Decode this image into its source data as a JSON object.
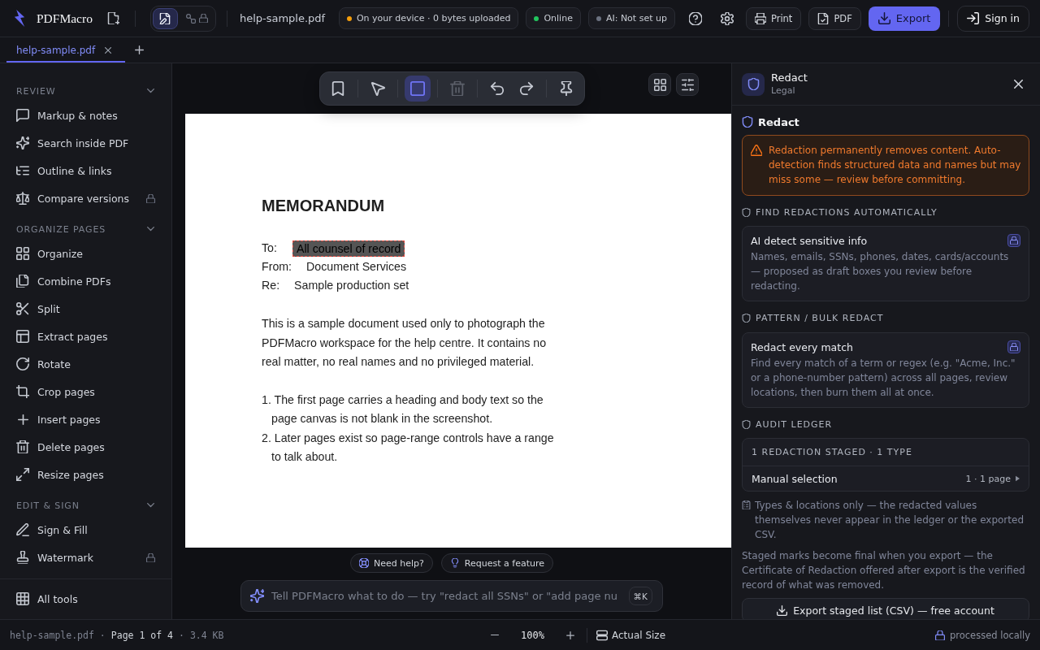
{
  "top_bar": {
    "brand": "PDFMacro",
    "modes": [
      {
        "selected": true,
        "locked": false
      },
      {
        "selected": false,
        "locked": true
      }
    ],
    "file_name": "help-sample.pdf",
    "status_pills": [
      {
        "label": "On your device · 0 bytes uploaded",
        "color": "#f59e0b"
      },
      {
        "label": "Online",
        "color": "#22c55e"
      },
      {
        "label": "AI: Not set up",
        "color": "#6b7280"
      }
    ],
    "buttons": [
      {
        "label": "Print",
        "kind": "secondary"
      },
      {
        "label": "PDF",
        "kind": "secondary"
      },
      {
        "label": "Export",
        "kind": "primary"
      },
      {
        "label": "Sign in",
        "kind": "outline"
      }
    ]
  },
  "tabs": [
    {
      "label": "help-sample.pdf",
      "selected": true
    }
  ],
  "sidebar": {
    "sections": [
      {
        "title": "REVIEW",
        "expanded": true,
        "items": [
          {
            "label": "Markup & notes",
            "locked": false
          },
          {
            "label": "Search inside PDF",
            "locked": false
          },
          {
            "label": "Outline & links",
            "locked": false
          },
          {
            "label": "Compare versions",
            "locked": true
          }
        ]
      },
      {
        "title": "ORGANIZE PAGES",
        "expanded": true,
        "items": [
          {
            "label": "Organize",
            "locked": false
          },
          {
            "label": "Combine PDFs",
            "locked": false
          },
          {
            "label": "Split",
            "locked": false
          },
          {
            "label": "Extract pages",
            "locked": false
          },
          {
            "label": "Rotate",
            "locked": false
          },
          {
            "label": "Crop pages",
            "locked": false
          },
          {
            "label": "Insert pages",
            "locked": false
          },
          {
            "label": "Delete pages",
            "locked": false
          },
          {
            "label": "Resize pages",
            "locked": false
          }
        ]
      },
      {
        "title": "EDIT & SIGN",
        "expanded": true,
        "items": [
          {
            "label": "Sign & Fill",
            "locked": false
          },
          {
            "label": "Watermark",
            "locked": true
          }
        ]
      }
    ],
    "footer_item": "All tools"
  },
  "toolbar": {
    "tools": [
      {
        "selected": false,
        "disabled": false
      },
      {
        "selected": false,
        "disabled": false
      },
      {
        "selected": true,
        "disabled": false
      },
      {
        "selected": false,
        "disabled": true
      },
      {
        "selected": false,
        "disabled": false
      },
      {
        "selected": false,
        "disabled": false
      },
      {
        "selected": false,
        "disabled": false
      }
    ]
  },
  "document": {
    "heading": "MEMORANDUM",
    "fields": [
      {
        "label": "To:",
        "value": "All counsel of record",
        "redacted": true
      },
      {
        "label": "From:",
        "value": "Document Services",
        "redacted": false
      },
      {
        "label": "Re:",
        "value": "Sample production set",
        "redacted": false
      }
    ],
    "body": "This is a sample document used only to photograph the PDFMacro workspace for the help centre. It contains no real matter, no real names and no privileged material.",
    "list": [
      "1. The first page carries a heading and body text so the page canvas is not blank in the screenshot.",
      "2. Later pages exist so page-range controls have a range to talk about."
    ]
  },
  "help_links": [
    "Need help?",
    "Request a feature"
  ],
  "command_bar": {
    "placeholder": "Tell PDFMacro what to do — try \"redact all SSNs\" or \"add page nu",
    "shortcut": "⌘K"
  },
  "panel": {
    "title": "Redact",
    "subtitle": "Legal",
    "heading": "Redact",
    "warning": "Redaction permanently removes content. Auto-detection finds structured data and names but may miss some — review before committing.",
    "sections": [
      {
        "kind": "feature",
        "title": "FIND REDACTIONS AUTOMATICALLY",
        "card": {
          "title": "AI detect sensitive info",
          "description": "Names, emails, SSNs, phones, dates, cards/accounts — proposed as draft boxes you review before redacting.",
          "locked": true
        }
      },
      {
        "kind": "feature",
        "title": "PATTERN / BULK REDACT",
        "card": {
          "title": "Redact every match",
          "description": "Find every match of a term or regex (e.g. \"Acme, Inc.\" or a phone-number pattern) across all pages, review locations, then burn them all at once.",
          "locked": true
        }
      },
      {
        "kind": "ledger",
        "title": "AUDIT LEDGER",
        "summary": "1 REDACTION STAGED · 1 TYPE",
        "rows": [
          {
            "label": "Manual selection",
            "detail": "1 · 1 page"
          }
        ]
      }
    ],
    "notes": [
      "Types & locations only — the redacted values themselves never appear in the ledger or the exported CSV.",
      "Staged marks become final when you export — the Certificate of Redaction offered after export is the verified record of what was removed."
    ],
    "export_button": "Export staged list (CSV) — free account"
  },
  "status_bar": {
    "separator": "·",
    "file_info": [
      {
        "kind": "file",
        "text": "help-sample.pdf"
      },
      {
        "kind": "page",
        "text": "Page 1 of 4"
      },
      {
        "kind": "size",
        "text": "3.4 KB"
      }
    ],
    "zoom": "100%",
    "fit": "Actual Size",
    "privacy": "processed locally"
  }
}
